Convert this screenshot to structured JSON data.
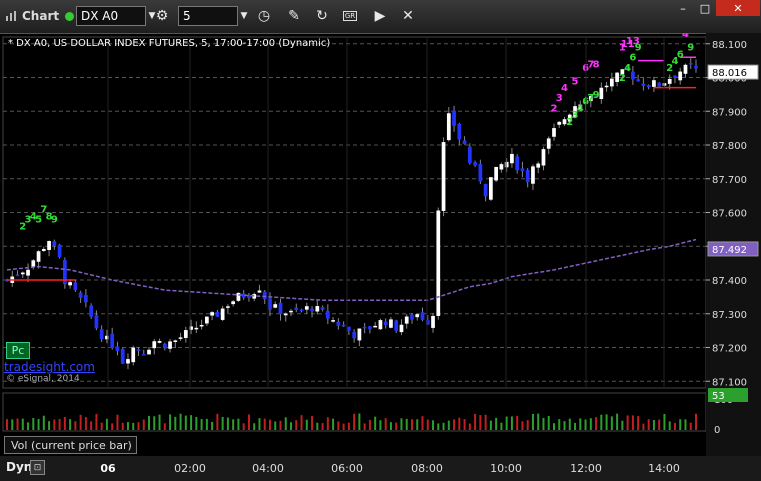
{
  "toolbar": {
    "app_label": "Chart",
    "symbol_value": "DX A0",
    "interval_value": "5",
    "icons": [
      "chart-icon",
      "symbol-settings-icon",
      "clock-icon",
      "draw-pencil-icon",
      "refresh-icon",
      "study-icon",
      "play-icon",
      "tools-icon"
    ]
  },
  "chart_title": "* DX A0, US DOLLAR INDEX FUTURES, 5, 17:00-17:00 (Dynamic)",
  "badges": {
    "pc": "Pc",
    "tradesight": "tradesight.com",
    "copyright": "© eSignal, 2014"
  },
  "vol_label": "Vol (current price bar)",
  "vol_value": "53",
  "vol_axis": [
    "100",
    "0"
  ],
  "dyn_label": "Dyn",
  "colors": {
    "bull": "#ffffff",
    "bear": "#2233ff",
    "ma": "#8060c0",
    "up_vol": "#2ca02c",
    "down_vol": "#c02020",
    "grid": "#555555"
  },
  "chart_data": {
    "type": "candlestick",
    "title": "* DX A0, US DOLLAR INDEX FUTURES, 5, 17:00-17:00 (Dynamic)",
    "y_ticks": [
      "88.100",
      "88.000",
      "87.900",
      "87.800",
      "87.700",
      "87.600",
      "87.500",
      "87.400",
      "87.300",
      "87.200",
      "87.100"
    ],
    "ylim": [
      87.08,
      88.12
    ],
    "x_ticks": [
      "06",
      "02:00",
      "04:00",
      "06:00",
      "08:00",
      "10:00",
      "12:00",
      "14:00"
    ],
    "last_price": "88.016",
    "ma_value": "87.492",
    "close_path": [
      [
        0,
        87.4
      ],
      [
        4,
        87.44
      ],
      [
        6,
        87.48
      ],
      [
        8,
        87.52
      ],
      [
        10,
        87.46
      ],
      [
        11,
        87.4
      ],
      [
        13,
        87.36
      ],
      [
        15,
        87.32
      ],
      [
        17,
        87.26
      ],
      [
        19,
        87.22
      ],
      [
        21,
        87.2
      ],
      [
        22,
        87.16
      ],
      [
        24,
        87.2
      ],
      [
        26,
        87.19
      ],
      [
        28,
        87.22
      ],
      [
        30,
        87.21
      ],
      [
        32,
        87.22
      ],
      [
        34,
        87.24
      ],
      [
        36,
        87.26
      ],
      [
        38,
        87.28
      ],
      [
        40,
        87.3
      ],
      [
        42,
        87.33
      ],
      [
        44,
        87.35
      ],
      [
        46,
        87.36
      ],
      [
        48,
        87.38
      ],
      [
        50,
        87.32
      ],
      [
        52,
        87.31
      ],
      [
        54,
        87.3
      ],
      [
        56,
        87.31
      ],
      [
        58,
        87.32
      ],
      [
        60,
        87.3
      ],
      [
        62,
        87.28
      ],
      [
        64,
        87.26
      ],
      [
        66,
        87.24
      ],
      [
        68,
        87.25
      ],
      [
        70,
        87.27
      ],
      [
        72,
        87.28
      ],
      [
        74,
        87.26
      ],
      [
        76,
        87.28
      ],
      [
        78,
        87.3
      ],
      [
        80,
        87.28
      ],
      [
        81,
        87.3
      ],
      [
        82,
        87.62
      ],
      [
        83,
        87.8
      ],
      [
        84,
        87.88
      ],
      [
        85,
        87.86
      ],
      [
        86,
        87.82
      ],
      [
        87,
        87.8
      ],
      [
        88,
        87.75
      ],
      [
        90,
        87.7
      ],
      [
        91,
        87.66
      ],
      [
        92,
        87.7
      ],
      [
        94,
        87.74
      ],
      [
        96,
        87.76
      ],
      [
        98,
        87.72
      ],
      [
        99,
        87.7
      ],
      [
        100,
        87.74
      ],
      [
        102,
        87.78
      ],
      [
        104,
        87.84
      ],
      [
        106,
        87.88
      ],
      [
        108,
        87.92
      ],
      [
        110,
        87.94
      ],
      [
        112,
        87.95
      ],
      [
        114,
        87.98
      ],
      [
        116,
        88.0
      ],
      [
        118,
        88.02
      ],
      [
        120,
        87.99
      ],
      [
        122,
        87.98
      ],
      [
        124,
        87.98
      ],
      [
        126,
        88.0
      ],
      [
        128,
        88.02
      ],
      [
        130,
        88.03
      ],
      [
        131,
        88.02
      ]
    ],
    "ma_path": [
      [
        0,
        87.43
      ],
      [
        6,
        87.44
      ],
      [
        12,
        87.43
      ],
      [
        20,
        87.4
      ],
      [
        30,
        87.37
      ],
      [
        40,
        87.36
      ],
      [
        50,
        87.35
      ],
      [
        60,
        87.34
      ],
      [
        70,
        87.34
      ],
      [
        80,
        87.34
      ],
      [
        84,
        87.36
      ],
      [
        88,
        87.38
      ],
      [
        92,
        87.39
      ],
      [
        96,
        87.41
      ],
      [
        100,
        87.42
      ],
      [
        104,
        87.43
      ],
      [
        110,
        87.45
      ],
      [
        116,
        87.47
      ],
      [
        122,
        87.49
      ],
      [
        126,
        87.5
      ],
      [
        131,
        87.52
      ]
    ],
    "seq_labels": [
      {
        "text": "2",
        "i": 3,
        "p": 87.55,
        "color": "#33dd33"
      },
      {
        "text": "3",
        "i": 4,
        "p": 87.57,
        "color": "#33dd33"
      },
      {
        "text": "4",
        "i": 5,
        "p": 87.58,
        "color": "#33dd33"
      },
      {
        "text": "5",
        "i": 6,
        "p": 87.57,
        "color": "#33dd33"
      },
      {
        "text": "7",
        "i": 7,
        "p": 87.6,
        "color": "#33dd33"
      },
      {
        "text": "8",
        "i": 8,
        "p": 87.58,
        "color": "#33dd33"
      },
      {
        "text": "9",
        "i": 9,
        "p": 87.57,
        "color": "#33dd33"
      },
      {
        "text": "2",
        "i": 104,
        "p": 87.9,
        "color": "#ff33ff"
      },
      {
        "text": "3",
        "i": 105,
        "p": 87.93,
        "color": "#ff33ff"
      },
      {
        "text": "4",
        "i": 106,
        "p": 87.96,
        "color": "#ff33ff"
      },
      {
        "text": "5",
        "i": 108,
        "p": 87.98,
        "color": "#ff33ff"
      },
      {
        "text": "6",
        "i": 110,
        "p": 88.02,
        "color": "#ff33ff"
      },
      {
        "text": "7",
        "i": 111,
        "p": 88.03,
        "color": "#ff33ff"
      },
      {
        "text": "8",
        "i": 112,
        "p": 88.03,
        "color": "#ff33ff"
      },
      {
        "text": "2",
        "i": 107,
        "p": 87.86,
        "color": "#33dd33"
      },
      {
        "text": "3",
        "i": 108,
        "p": 87.88,
        "color": "#33dd33"
      },
      {
        "text": "4",
        "i": 109,
        "p": 87.9,
        "color": "#33dd33"
      },
      {
        "text": "6",
        "i": 110,
        "p": 87.92,
        "color": "#33dd33"
      },
      {
        "text": "7",
        "i": 111,
        "p": 87.93,
        "color": "#33dd33"
      },
      {
        "text": "9",
        "i": 112,
        "p": 87.94,
        "color": "#33dd33"
      },
      {
        "text": "1",
        "i": 117,
        "p": 88.08,
        "color": "#ff33ff"
      },
      {
        "text": "11",
        "i": 118,
        "p": 88.09,
        "color": "#ff33ff"
      },
      {
        "text": "13",
        "i": 119,
        "p": 88.1,
        "color": "#ff33ff"
      },
      {
        "text": "2",
        "i": 117,
        "p": 87.99,
        "color": "#33dd33"
      },
      {
        "text": "4",
        "i": 118,
        "p": 88.02,
        "color": "#33dd33"
      },
      {
        "text": "6",
        "i": 119,
        "p": 88.05,
        "color": "#33dd33"
      },
      {
        "text": "9",
        "i": 120,
        "p": 88.08,
        "color": "#33dd33"
      },
      {
        "text": "2",
        "i": 126,
        "p": 88.02,
        "color": "#33dd33"
      },
      {
        "text": "4",
        "i": 127,
        "p": 88.04,
        "color": "#33dd33"
      },
      {
        "text": "6",
        "i": 128,
        "p": 88.06,
        "color": "#33dd33"
      },
      {
        "text": "9",
        "i": 130,
        "p": 88.08,
        "color": "#33dd33"
      },
      {
        "text": "4",
        "i": 129,
        "p": 88.12,
        "color": "#ff33ff"
      }
    ],
    "level_lines": [
      {
        "p": 87.4,
        "from": 0,
        "to": 13,
        "color": "#ff2020"
      },
      {
        "p": 88.05,
        "from": 120,
        "to": 125,
        "color": "#ff33ff"
      },
      {
        "p": 88.06,
        "from": 128,
        "to": 131,
        "color": "#ff33ff"
      },
      {
        "p": 87.97,
        "from": 123,
        "to": 131,
        "color": "#ff2020"
      }
    ]
  }
}
